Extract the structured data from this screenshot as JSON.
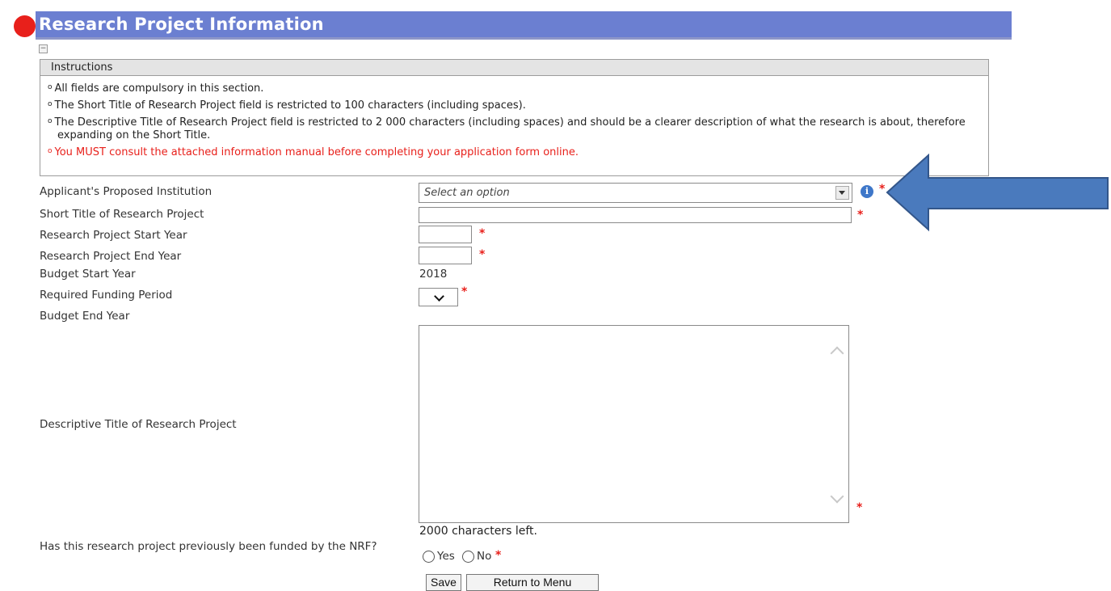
{
  "header": {
    "title": "Research Project Information"
  },
  "instructions": {
    "heading": "Instructions",
    "items": [
      "All fields are compulsory in this section.",
      "The Short Title of Research Project field is restricted to 100 characters (including spaces).",
      "The Descriptive Title of Research Project field is restricted to 2 000 characters (including spaces) and should be a clearer description of what the research is about, therefore expanding on the Short Title.",
      "You MUST consult the attached information manual before completing your application form online."
    ]
  },
  "form": {
    "institution": {
      "label": "Applicant's Proposed Institution",
      "placeholder": "Select an option"
    },
    "short_title": {
      "label": "Short Title of Research Project",
      "value": ""
    },
    "start_year": {
      "label": "Research Project Start Year",
      "value": ""
    },
    "end_year": {
      "label": "Research Project End Year",
      "value": ""
    },
    "budget_start": {
      "label": "Budget Start Year",
      "value": "2018"
    },
    "funding_period": {
      "label": "Required Funding Period",
      "value": ""
    },
    "budget_end": {
      "label": "Budget End Year",
      "value": ""
    },
    "descriptive_title": {
      "label": "Descriptive Title of Research Project",
      "value": "",
      "chars_left": "2000 characters left."
    },
    "previously_funded": {
      "label": "Has this research project previously been funded by the NRF?",
      "options": [
        "Yes",
        "No"
      ]
    },
    "required_marker": "*"
  },
  "buttons": {
    "save": "Save",
    "return": "Return to Menu"
  },
  "colors": {
    "header_bg": "#6b7fd1",
    "header_dot": "#e8201b",
    "required": "#e8201b",
    "annotation_arrow": "#3d6db3"
  },
  "icons": {
    "collapse": "minus-box-icon",
    "info": "info-icon",
    "annotation": "left-arrow-icon"
  }
}
